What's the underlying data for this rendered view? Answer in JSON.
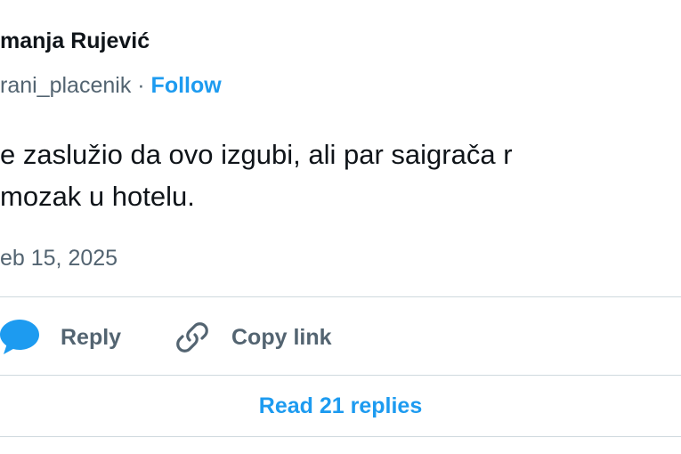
{
  "author": {
    "name": "manja Rujević",
    "handle": "rani_placenik",
    "separator": " · ",
    "follow_label": "Follow"
  },
  "tweet": {
    "text_line_1": "e zaslužio da ovo izgubi, ali par saigrača r",
    "text_line_2": "mozak u hotelu.",
    "timestamp": "eb 15, 2025"
  },
  "actions": {
    "reply_label": "Reply",
    "copy_link_label": "Copy link"
  },
  "footer": {
    "read_replies_label": "Read 21 replies"
  },
  "colors": {
    "accent": "#1d9bf0",
    "secondary_text": "#536471",
    "divider": "#cfd9de"
  },
  "icons": {
    "reply": "speech-bubble-icon",
    "copy_link": "link-icon"
  }
}
